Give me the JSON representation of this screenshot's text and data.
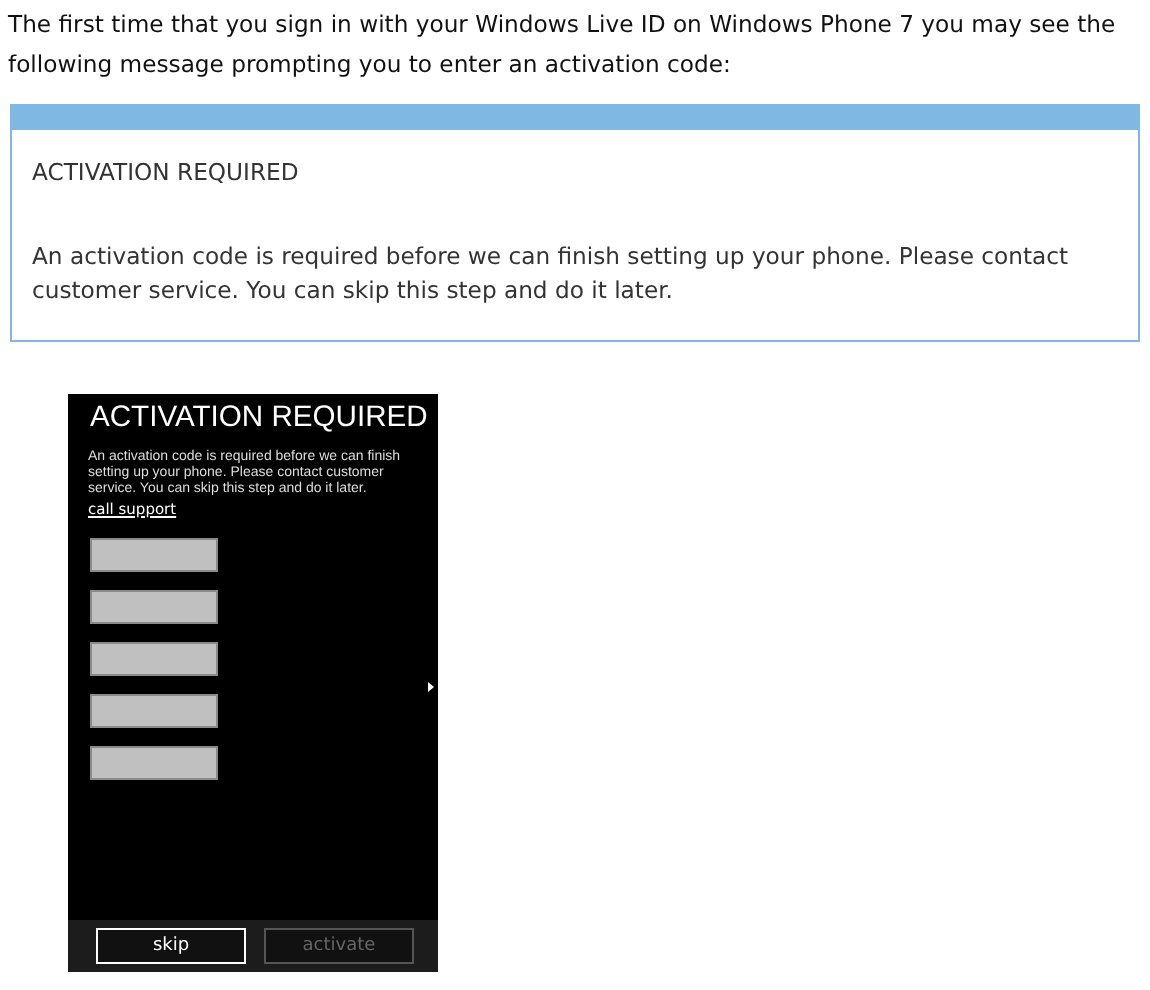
{
  "intro": "The first time that you sign in with your Windows Live ID on Windows Phone 7 you may see the following message prompting you to enter an activation code:",
  "message_box": {
    "title": "ACTIVATION REQUIRED",
    "body": "An activation code is required before we can finish setting up your phone. Please contact customer service. You can skip this step and do it later."
  },
  "phone": {
    "title": "ACTIVATION REQUIRED",
    "body": "An activation code is required before we can finish setting up your phone.  Please contact customer service.  You can skip this step and do it later.",
    "link": "call support",
    "fields": [
      {
        "kind": "input"
      },
      {
        "kind": "input"
      },
      {
        "kind": "input"
      },
      {
        "kind": "input"
      },
      {
        "kind": "input"
      }
    ],
    "buttons": [
      {
        "label": "skip",
        "disabled": false
      },
      {
        "label": "activate",
        "disabled": true
      }
    ]
  }
}
